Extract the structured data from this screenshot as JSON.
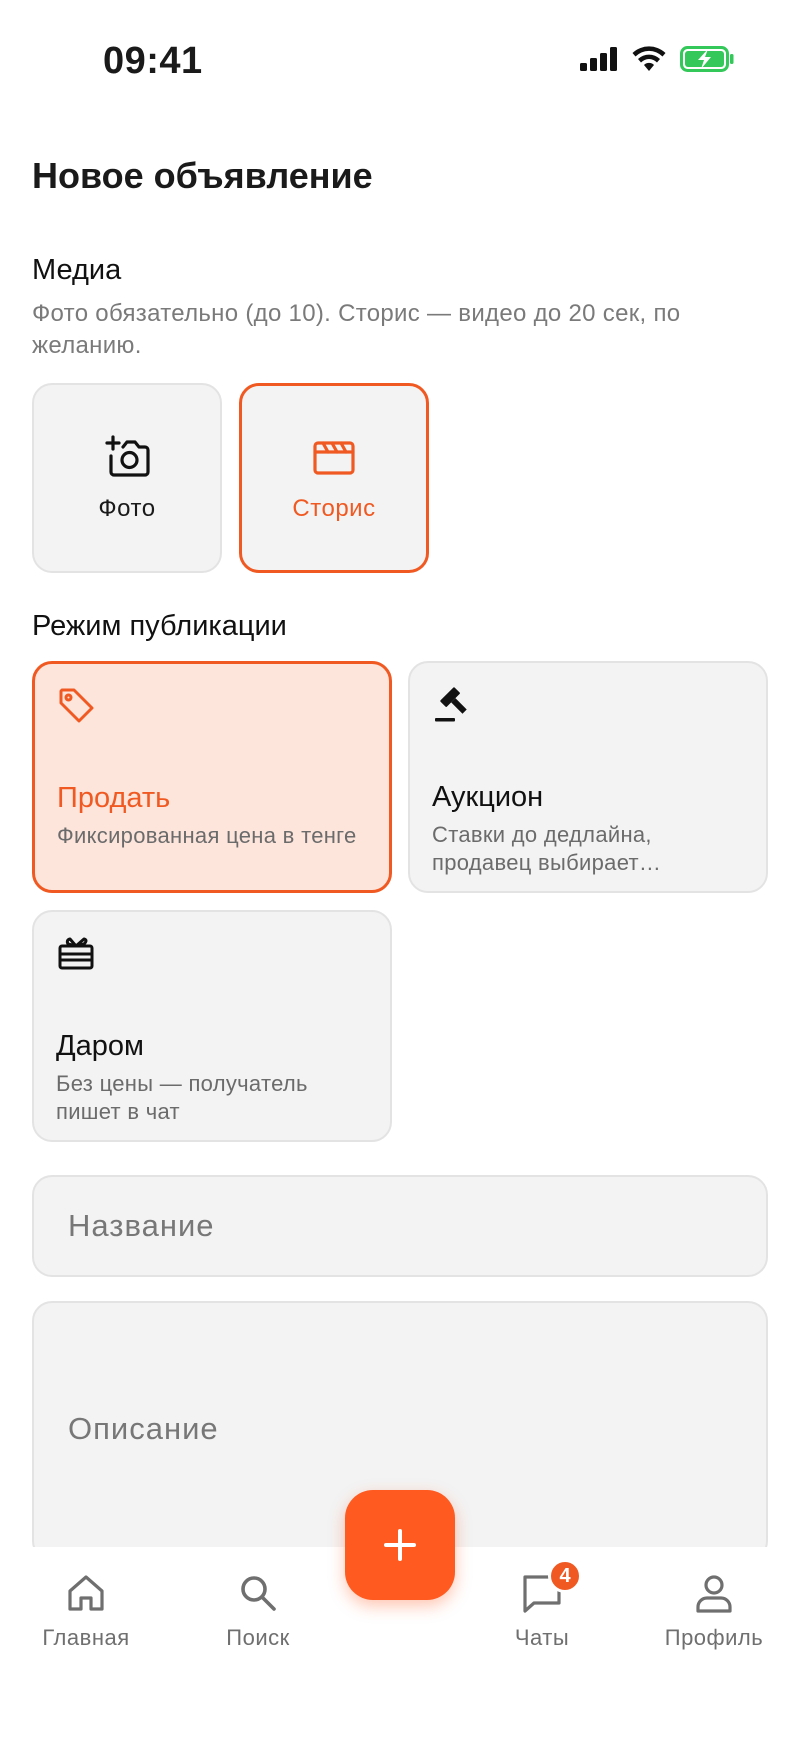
{
  "status_bar": {
    "time": "09:41"
  },
  "header": {
    "title": "Новое объявление"
  },
  "media": {
    "title": "Медиа",
    "description": "Фото обязательно (до 10). Сторис — видео до 20 сек, по желанию.",
    "tiles": [
      {
        "label": "Фото",
        "icon": "add-photo-icon",
        "selected": false
      },
      {
        "label": "Сторис",
        "icon": "clapperboard-icon",
        "selected": true
      }
    ]
  },
  "publication": {
    "title": "Режим публикации",
    "modes": [
      {
        "title": "Продать",
        "description": "Фиксированная цена в тенге",
        "icon": "price-tag-icon",
        "selected": true
      },
      {
        "title": "Аукцион",
        "description": "Ставки до дедлайна, продавец выбирает победителя",
        "icon": "gavel-icon",
        "selected": false
      },
      {
        "title": "Даром",
        "description": "Без цены — получатель пишет в чат",
        "icon": "gift-icon",
        "selected": false
      }
    ]
  },
  "form": {
    "name_placeholder": "Название",
    "description_placeholder": "Описание"
  },
  "bottom_nav": {
    "items": [
      {
        "label": "Главная",
        "icon": "home-icon"
      },
      {
        "label": "Поиск",
        "icon": "search-icon"
      },
      {
        "label": "Чаты",
        "icon": "chat-icon",
        "badge": "4"
      },
      {
        "label": "Профиль",
        "icon": "profile-icon"
      }
    ],
    "fab_icon": "plus-icon"
  },
  "colors": {
    "accent": "#f05a22",
    "accent_bg": "#fde5dc",
    "card_bg": "#f3f3f3",
    "battery": "#34c759"
  }
}
